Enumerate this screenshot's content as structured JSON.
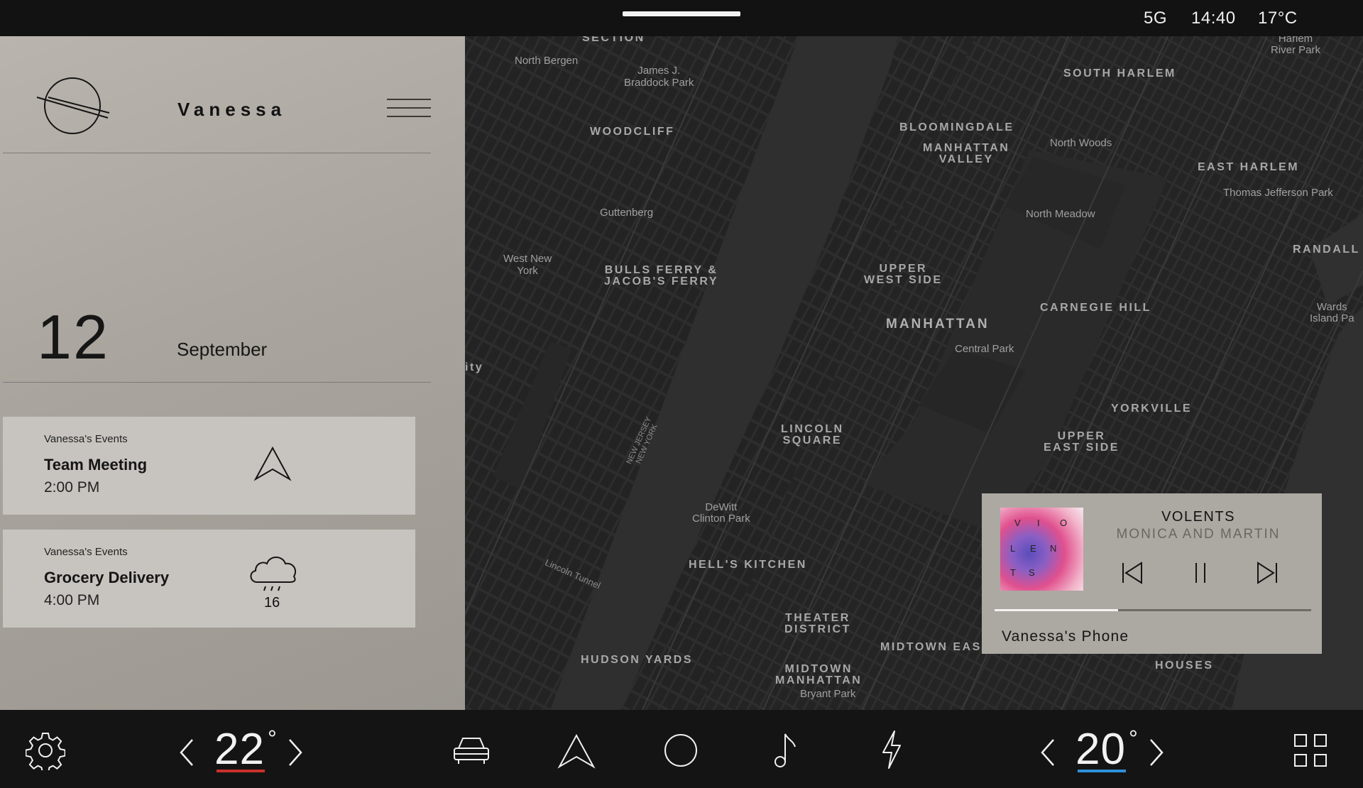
{
  "status": {
    "network": "5G",
    "time": "14:40",
    "temperature": "17°C"
  },
  "profile": {
    "name": "Vanessa",
    "logo_icon": "brand-logo-icon",
    "menu_icon": "hamburger-menu-icon"
  },
  "date": {
    "day": "12",
    "month": "September"
  },
  "events": [
    {
      "calendar": "Vanessa's Events",
      "title": "Team Meeting",
      "time": "2:00 PM",
      "icon": "navigation-arrow-icon"
    },
    {
      "calendar": "Vanessa's Events",
      "title": "Grocery Delivery",
      "time": "4:00 PM",
      "icon": "rain-cloud-icon",
      "weather_value": "16"
    }
  ],
  "map": {
    "labels": {
      "section": "SECTION",
      "north_bergen": "North Bergen",
      "braddock": "James J.\nBraddock Park",
      "woodcliff": "WOODCLIFF",
      "guttenberg": "Guttenberg",
      "west_new_york": "West New\nYork",
      "bulls_ferry": "BULLS FERRY &\nJACOB'S FERRY",
      "ity": "ity",
      "south_harlem": "SOUTH HARLEM",
      "harlem_river_park": "Harlem\nRiver Park",
      "bloomingdale": "BLOOMINGDALE",
      "manhattan_valley": "MANHATTAN\nVALLEY",
      "north_woods": "North Woods",
      "east_harlem": "EAST HARLEM",
      "thomas_jefferson": "Thomas Jefferson Park",
      "north_meadow": "North Meadow",
      "randall": "RANDALL",
      "upper_west_side": "UPPER\nWEST SIDE",
      "carnegie_hill": "CARNEGIE HILL",
      "manhattan": "MANHATTAN",
      "central_park": "Central Park",
      "wards_island": "Wards\nIsland Pa",
      "lincoln_square": "LINCOLN\nSQUARE",
      "yorkville": "YORKVILLE",
      "upper_east_side": "UPPER\nEAST SIDE",
      "dewitt_clinton": "DeWitt\nClinton Park",
      "hells_kitchen": "HELL'S KITCHEN",
      "theater_district": "THEATER\nDISTRICT",
      "midtown_east": "MIDTOWN EAS",
      "houses": "HOUSES",
      "hudson_yards": "HUDSON YARDS",
      "midtown_manhattan": "MIDTOWN\nMANHATTAN",
      "bryant_park": "Bryant Park",
      "lincoln_tunnel": "Lincoln Tunnel",
      "nj_ny": "NEW JERSEY\nNEW YORK"
    }
  },
  "player": {
    "song": "VOLENTS",
    "artist": "MONICA AND MARTIN",
    "art_letters": [
      "V",
      "I",
      "O",
      "L",
      "E",
      "N",
      "T",
      "S"
    ],
    "progress": 0.39,
    "device": "Vanessa's Phone"
  },
  "climate": {
    "driver_temp": "22",
    "passenger_temp": "20",
    "degree": "°",
    "driver_color": "#c8312b",
    "passenger_color": "#2f8fd8"
  },
  "nav": [
    "settings-icon",
    "car-icon",
    "navigation-icon",
    "home-icon",
    "music-icon",
    "charging-icon",
    "apps-grid-icon"
  ]
}
